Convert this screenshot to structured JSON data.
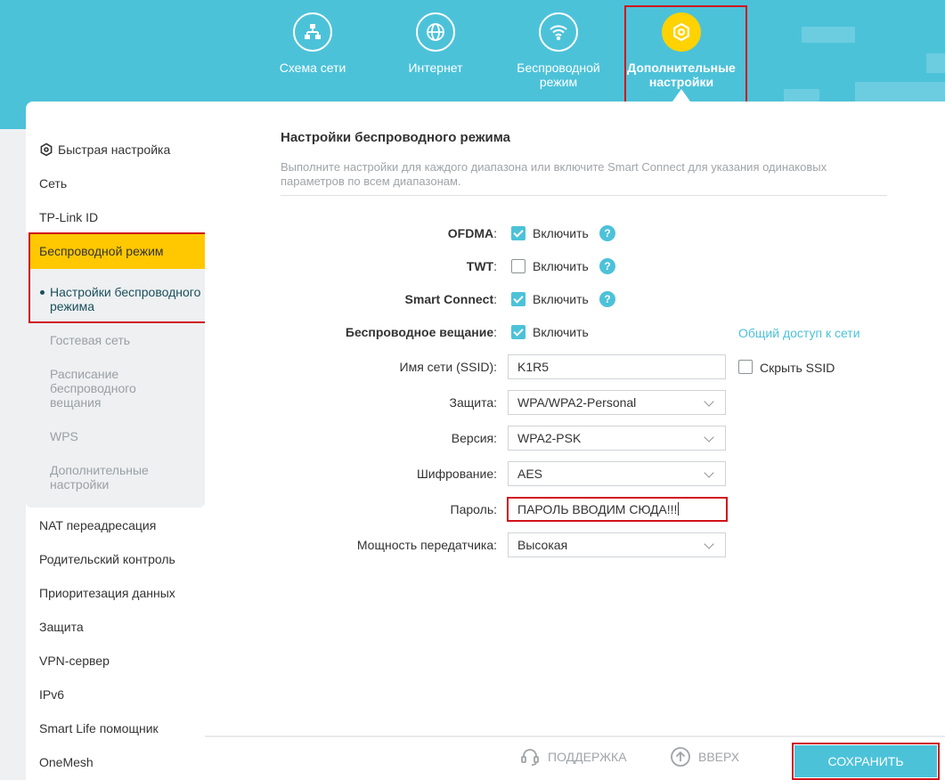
{
  "colors": {
    "accent": "#4cc2d9",
    "active_tab": "#ffd200",
    "highlight": "#d0121b",
    "sidebar_active": "#ffc800"
  },
  "nav": [
    {
      "label": "Схема сети",
      "icon": "network-map-icon"
    },
    {
      "label": "Интернет",
      "icon": "globe-icon"
    },
    {
      "label": "Беспроводной режим",
      "icon": "wifi-icon"
    },
    {
      "label": "Дополнительные настройки",
      "icon": "gear-icon",
      "active": true
    }
  ],
  "sidebar": {
    "quick_setup": "Быстрая настройка",
    "network": "Сеть",
    "tplink_id": "TP-Link ID",
    "wireless": "Беспроводной режим",
    "sub": {
      "wireless_settings": "Настройки беспроводного режима",
      "guest": "Гостевая сеть",
      "schedule": "Расписание беспроводного вещания",
      "wps": "WPS",
      "advanced": "Дополнительные настройки"
    },
    "nat": "NAT переадресация",
    "parental": "Родительский контроль",
    "qos": "Приоритезация данных",
    "security": "Защита",
    "vpn": "VPN-сервер",
    "ipv6": "IPv6",
    "smartlife": "Smart Life помощник",
    "onemesh": "OneMesh"
  },
  "main": {
    "title": "Настройки беспроводного режима",
    "description": "Выполните настройки для каждого диапазона или включите Smart Connect для указания одинаковых параметров по всем диапазонам.",
    "ofdma": {
      "label": "OFDMA",
      "colon": ":",
      "checked": true,
      "text": "Включить"
    },
    "twt": {
      "label": "TWT",
      "colon": ":",
      "checked": false,
      "text": "Включить"
    },
    "smart_connect": {
      "label": "Smart Connect",
      "colon": ":",
      "checked": true,
      "text": "Включить"
    },
    "broadcast": {
      "label": "Беспроводное вещание",
      "colon": ":",
      "checked": true,
      "text": "Включить"
    },
    "share_link": "Общий доступ к сети",
    "ssid": {
      "label": "Имя сети (SSID):",
      "value": "K1R5"
    },
    "hide_ssid": "Скрыть SSID",
    "security": {
      "label": "Защита:",
      "value": "WPA/WPA2-Personal"
    },
    "version": {
      "label": "Версия:",
      "value": "WPA2-PSK"
    },
    "encryption": {
      "label": "Шифрование:",
      "value": "AES"
    },
    "password": {
      "label": "Пароль:",
      "value": "ПАРОЛЬ ВВОДИМ СЮДА!!!"
    },
    "tx_power": {
      "label": "Мощность передатчика:",
      "value": "Высокая"
    }
  },
  "footer": {
    "support": "ПОДДЕРЖКА",
    "top": "ВВЕРХ",
    "save": "СОХРАНИТЬ"
  }
}
